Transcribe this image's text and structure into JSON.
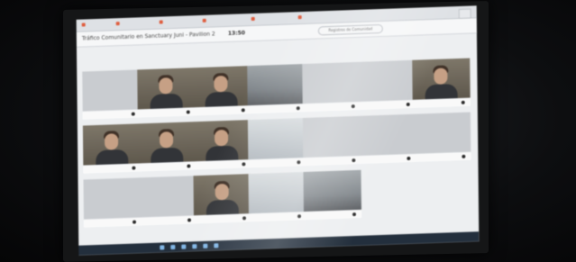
{
  "screen": {
    "meeting_title": "Tráfico Comunitario en Sanctuary Juni - Pavilion 2",
    "timer": "13:50",
    "join_pill": "Registros de Comunidad"
  },
  "tiles": [
    {
      "kind": "placeholder",
      "label": ""
    },
    {
      "kind": "person",
      "label": ""
    },
    {
      "kind": "person",
      "label": ""
    },
    {
      "kind": "room2",
      "label": ""
    },
    {
      "kind": "placeholder",
      "label": ""
    },
    {
      "kind": "placeholder",
      "label": ""
    },
    {
      "kind": "person",
      "label": ""
    },
    {
      "kind": "person",
      "label": ""
    },
    {
      "kind": "person",
      "label": ""
    },
    {
      "kind": "person",
      "label": ""
    },
    {
      "kind": "window",
      "label": ""
    },
    {
      "kind": "placeholder",
      "label": ""
    },
    {
      "kind": "placeholder",
      "label": ""
    },
    {
      "kind": "placeholder",
      "label": ""
    },
    {
      "kind": "placeholder",
      "label": ""
    },
    {
      "kind": "placeholder",
      "label": ""
    },
    {
      "kind": "person",
      "label": ""
    },
    {
      "kind": "window",
      "label": ""
    },
    {
      "kind": "room2",
      "label": ""
    }
  ]
}
